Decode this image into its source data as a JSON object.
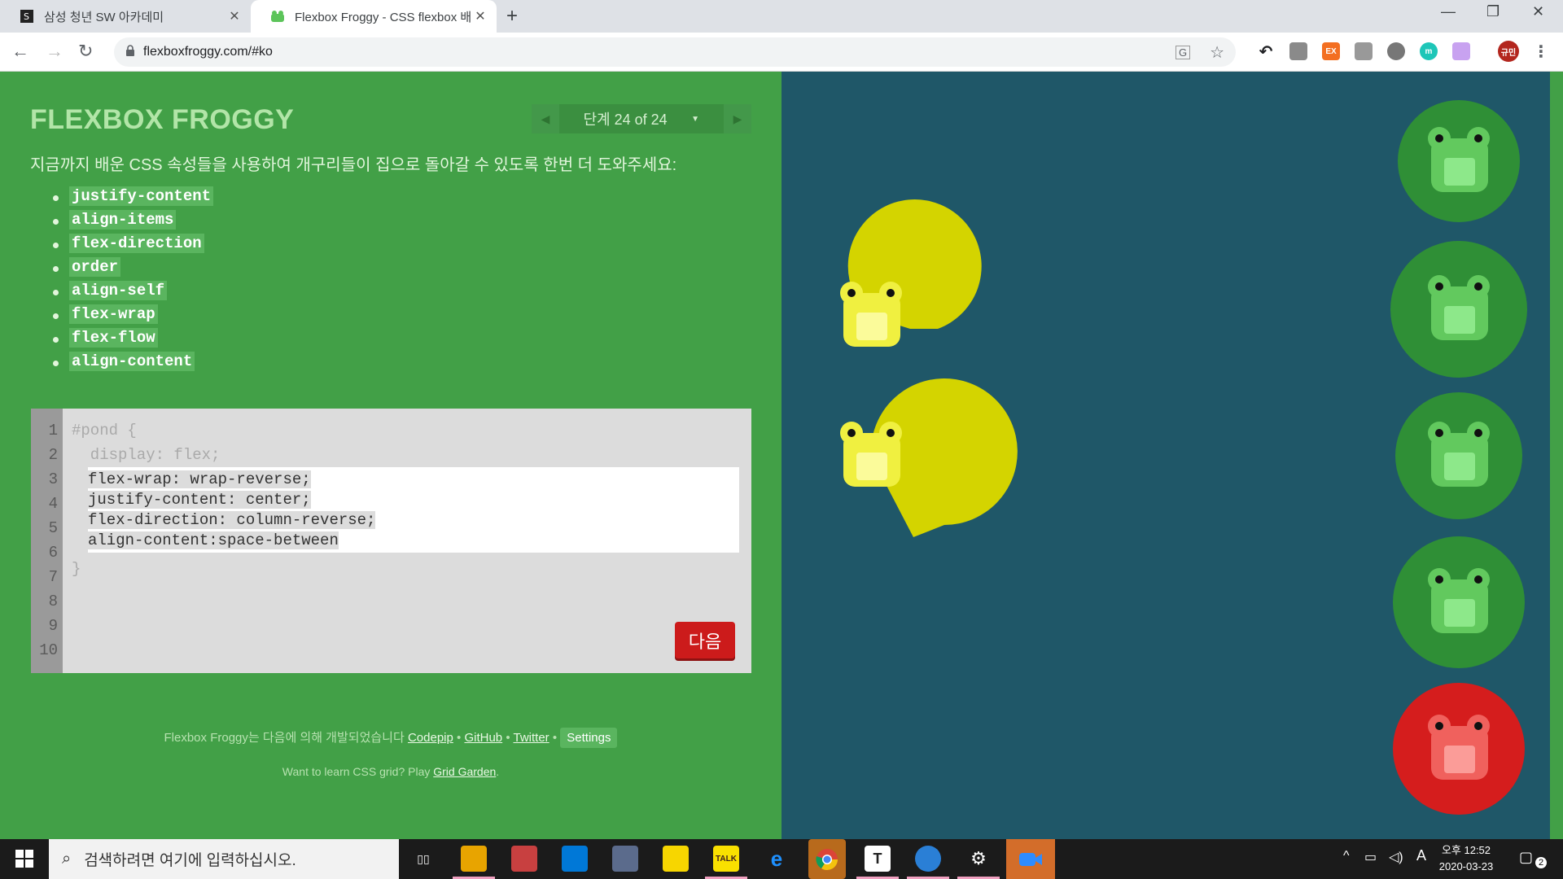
{
  "browser": {
    "tabs": [
      {
        "title": "삼성 청년 SW 아카데미",
        "active": false
      },
      {
        "title": "Flexbox Froggy - CSS flexbox 배우기 게임",
        "active": true
      }
    ],
    "url": "flexboxfroggy.com/#ko",
    "profile_label": "규민"
  },
  "game": {
    "logo": "FLEXBOX FROGGY",
    "level_label": "단계 24 of 24",
    "instructions": "지금까지 배운 CSS 속성들을 사용하여 개구리들이 집으로 돌아갈 수 있도록 한번 더 도와주세요:",
    "properties": [
      "justify-content",
      "align-items",
      "flex-direction",
      "order",
      "align-self",
      "flex-wrap",
      "flex-flow",
      "align-content"
    ],
    "line_numbers": [
      "1",
      "2",
      "3",
      "4",
      "5",
      "6",
      "7",
      "8",
      "9",
      "10"
    ],
    "code_before": [
      "#pond {",
      "  display: flex;"
    ],
    "user_code": [
      "flex-wrap: wrap-reverse;",
      "justify-content: center;",
      "flex-direction: column-reverse;",
      "align-content:space-between"
    ],
    "code_after": "}",
    "next_button": "다음",
    "credits_prefix": "Flexbox Froggy는 다음에 의해 개발되었습니다",
    "credit_links": [
      "Codepip",
      "GitHub",
      "Twitter"
    ],
    "separator": "•",
    "settings_label": "Settings",
    "grid_prefix": "Want to learn CSS grid? Play",
    "grid_link": "Grid Garden",
    "grid_suffix": ".",
    "pond_color": "#1f5768"
  },
  "taskbar": {
    "search_placeholder": "검색하려면 여기에 입력하십시오.",
    "time": "오후 12:52",
    "date": "2020-03-23",
    "notification_count": "2",
    "ime": "A"
  }
}
